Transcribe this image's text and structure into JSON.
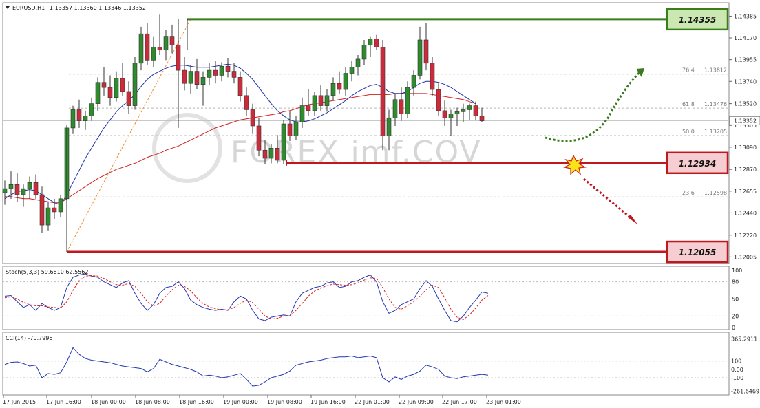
{
  "header": {
    "title": "EURUSD,H1",
    "ohlc": "1.13357 1.13360 1.13346 1.13352"
  },
  "watermark": "FOREX imf.COV",
  "colors": {
    "bull": "#2e8b2e",
    "bear": "#cc2b3b",
    "ma_slow": "#d42020",
    "ma_fast": "#1f2fa8",
    "stoch_main": "#2436b0",
    "stoch_signal": "#d42020",
    "cci": "#2436b0",
    "resistance": "#3a7d1a",
    "support": "#c0181f"
  },
  "chart_data": [
    {
      "type": "candlestick",
      "name": "main",
      "ylim": [
        1.1196,
        1.1449
      ],
      "y_ticks": [
        "1.14385",
        "1.14170",
        "1.13955",
        "1.13740",
        "1.13520",
        "1.13305",
        "1.13090",
        "1.12870",
        "1.12655",
        "1.12440",
        "1.12220",
        "1.12005"
      ],
      "price_label": "1.13352",
      "last_price": 1.13352,
      "x_labels": [
        "17 Jun 2015",
        "17 Jun 16:00",
        "18 Jun 00:00",
        "18 Jun 08:00",
        "18 Jun 16:00",
        "19 Jun 00:00",
        "19 Jun 08:00",
        "19 Jun 16:00",
        "22 Jun 01:00",
        "22 Jun 09:00",
        "22 Jun 17:00",
        "23 Jun 01:00"
      ],
      "ohlc": [
        [
          1.1264,
          1.1276,
          1.1252,
          1.1268
        ],
        [
          1.1268,
          1.1285,
          1.1258,
          1.1272
        ],
        [
          1.1272,
          1.1283,
          1.1255,
          1.1262
        ],
        [
          1.1262,
          1.1272,
          1.125,
          1.1268
        ],
        [
          1.1268,
          1.128,
          1.1258,
          1.1274
        ],
        [
          1.1274,
          1.1282,
          1.1258,
          1.1262
        ],
        [
          1.1262,
          1.127,
          1.1224,
          1.1232
        ],
        [
          1.1232,
          1.1255,
          1.1226,
          1.1249
        ],
        [
          1.1249,
          1.1258,
          1.1238,
          1.1245
        ],
        [
          1.1245,
          1.1262,
          1.124,
          1.1258
        ],
        [
          1.1258,
          1.1331,
          1.1252,
          1.1328
        ],
        [
          1.1328,
          1.135,
          1.1322,
          1.1346
        ],
        [
          1.1346,
          1.1356,
          1.1328,
          1.1335
        ],
        [
          1.1335,
          1.1345,
          1.1326,
          1.134
        ],
        [
          1.134,
          1.1358,
          1.1335,
          1.1352
        ],
        [
          1.1352,
          1.1378,
          1.1345,
          1.1373
        ],
        [
          1.1373,
          1.1388,
          1.136,
          1.1368
        ],
        [
          1.1368,
          1.138,
          1.135,
          1.1358
        ],
        [
          1.1358,
          1.1384,
          1.1354,
          1.1377
        ],
        [
          1.1377,
          1.1392,
          1.136,
          1.1364
        ],
        [
          1.1364,
          1.1374,
          1.1342,
          1.135
        ],
        [
          1.135,
          1.1398,
          1.1346,
          1.1392
        ],
        [
          1.1392,
          1.1428,
          1.1385,
          1.1421
        ],
        [
          1.1421,
          1.1432,
          1.139,
          1.1395
        ],
        [
          1.1395,
          1.1418,
          1.1388,
          1.1408
        ],
        [
          1.1408,
          1.144,
          1.14,
          1.1405
        ],
        [
          1.1405,
          1.1425,
          1.1395,
          1.1418
        ],
        [
          1.1418,
          1.143,
          1.1402,
          1.141
        ],
        [
          1.141,
          1.1436,
          1.1328,
          1.1385
        ],
        [
          1.1385,
          1.1398,
          1.1365,
          1.1372
        ],
        [
          1.1372,
          1.139,
          1.1362,
          1.1384
        ],
        [
          1.1384,
          1.1396,
          1.1366,
          1.1371
        ],
        [
          1.1371,
          1.1384,
          1.135,
          1.1378
        ],
        [
          1.1378,
          1.1392,
          1.137,
          1.1385
        ],
        [
          1.1385,
          1.1394,
          1.1372,
          1.138
        ],
        [
          1.138,
          1.1393,
          1.1374,
          1.1389
        ],
        [
          1.1389,
          1.1397,
          1.1378,
          1.1384
        ],
        [
          1.1384,
          1.1392,
          1.1372,
          1.1378
        ],
        [
          1.1378,
          1.1384,
          1.1354,
          1.136
        ],
        [
          1.136,
          1.1368,
          1.134,
          1.1346
        ],
        [
          1.1346,
          1.1352,
          1.1322,
          1.133
        ],
        [
          1.133,
          1.1338,
          1.13,
          1.1306
        ],
        [
          1.1306,
          1.1316,
          1.1292,
          1.1298
        ],
        [
          1.1298,
          1.1312,
          1.1293,
          1.1308
        ],
        [
          1.1308,
          1.1321,
          1.1293,
          1.1296
        ],
        [
          1.1296,
          1.1336,
          1.1292,
          1.1332
        ],
        [
          1.1332,
          1.1345,
          1.1315,
          1.132
        ],
        [
          1.132,
          1.134,
          1.1316,
          1.1334
        ],
        [
          1.1334,
          1.1358,
          1.1328,
          1.135
        ],
        [
          1.135,
          1.1366,
          1.134,
          1.1345
        ],
        [
          1.1345,
          1.1364,
          1.134,
          1.136
        ],
        [
          1.136,
          1.137,
          1.1345,
          1.135
        ],
        [
          1.135,
          1.1366,
          1.1344,
          1.136
        ],
        [
          1.136,
          1.1378,
          1.1355,
          1.1372
        ],
        [
          1.1372,
          1.1384,
          1.1362,
          1.1366
        ],
        [
          1.1366,
          1.1388,
          1.136,
          1.1382
        ],
        [
          1.1382,
          1.1394,
          1.1374,
          1.1388
        ],
        [
          1.1388,
          1.14,
          1.138,
          1.1396
        ],
        [
          1.1396,
          1.1415,
          1.139,
          1.141
        ],
        [
          1.141,
          1.1418,
          1.1398,
          1.1416
        ],
        [
          1.1416,
          1.142,
          1.1405,
          1.1408
        ],
        [
          1.1408,
          1.1415,
          1.1306,
          1.132
        ],
        [
          1.132,
          1.1346,
          1.1306,
          1.1338
        ],
        [
          1.1338,
          1.1362,
          1.133,
          1.1356
        ],
        [
          1.1356,
          1.1368,
          1.1335,
          1.1342
        ],
        [
          1.1342,
          1.1374,
          1.1338,
          1.1368
        ],
        [
          1.1368,
          1.1385,
          1.136,
          1.138
        ],
        [
          1.138,
          1.1428,
          1.1376,
          1.1415
        ],
        [
          1.1415,
          1.1432,
          1.1385,
          1.1392
        ],
        [
          1.1392,
          1.1398,
          1.136,
          1.1366
        ],
        [
          1.1366,
          1.1372,
          1.134,
          1.1345
        ],
        [
          1.1345,
          1.1355,
          1.133,
          1.1338
        ],
        [
          1.1338,
          1.1346,
          1.132,
          1.1342
        ],
        [
          1.1342,
          1.1348,
          1.133,
          1.1344
        ],
        [
          1.1344,
          1.1352,
          1.1334,
          1.1346
        ],
        [
          1.1346,
          1.1352,
          1.1336,
          1.135
        ],
        [
          1.135,
          1.1354,
          1.1336,
          1.134
        ],
        [
          1.134,
          1.1348,
          1.1334,
          1.1335
        ]
      ],
      "ma_slow": [
        1.126,
        1.126,
        1.1259,
        1.1258,
        1.1258,
        1.1257,
        1.1256,
        1.1255,
        1.1254,
        1.1254,
        1.1258,
        1.1262,
        1.1266,
        1.127,
        1.1274,
        1.1278,
        1.1281,
        1.1284,
        1.1287,
        1.1289,
        1.1291,
        1.1293,
        1.1296,
        1.1299,
        1.1301,
        1.1303,
        1.1306,
        1.1308,
        1.131,
        1.1313,
        1.1316,
        1.1319,
        1.1322,
        1.1325,
        1.1328,
        1.133,
        1.1332,
        1.1334,
        1.1336,
        1.1337,
        1.1338,
        1.1339,
        1.134,
        1.1341,
        1.1342,
        1.1344,
        1.1345,
        1.1347,
        1.1349,
        1.1351,
        1.1352,
        1.1353,
        1.1354,
        1.1355,
        1.1356,
        1.1357,
        1.1358,
        1.1359,
        1.136,
        1.1361,
        1.1361,
        1.1361,
        1.1361,
        1.1362,
        1.1362,
        1.1362,
        1.1362,
        1.1362,
        1.1362,
        1.1361,
        1.136,
        1.1359,
        1.1358,
        1.1357,
        1.1356,
        1.1354,
        1.1352
      ],
      "ma_fast": [
        1.1258,
        1.1262,
        1.1265,
        1.1266,
        1.1267,
        1.1266,
        1.1262,
        1.1258,
        1.1254,
        1.1252,
        1.1262,
        1.1274,
        1.1286,
        1.1298,
        1.1308,
        1.1318,
        1.1328,
        1.1336,
        1.1344,
        1.135,
        1.1355,
        1.1361,
        1.1369,
        1.1376,
        1.1381,
        1.1384,
        1.1387,
        1.1389,
        1.139,
        1.139,
        1.1389,
        1.1388,
        1.1388,
        1.1388,
        1.1389,
        1.139,
        1.1391,
        1.139,
        1.1387,
        1.1382,
        1.1376,
        1.1368,
        1.136,
        1.1352,
        1.1345,
        1.134,
        1.1336,
        1.1334,
        1.1334,
        1.1335,
        1.1337,
        1.134,
        1.1343,
        1.1347,
        1.1351,
        1.1355,
        1.136,
        1.1364,
        1.1367,
        1.137,
        1.1371,
        1.1368,
        1.1364,
        1.1362,
        1.1362,
        1.1364,
        1.1368,
        1.1372,
        1.1374,
        1.1374,
        1.1373,
        1.1371,
        1.1368,
        1.1364,
        1.136,
        1.1356,
        1.1352
      ],
      "fibonacci": [
        {
          "label": "76.4",
          "value": 1.13812
        },
        {
          "label": "61.8",
          "value": 1.13476
        },
        {
          "label": "50.0",
          "value": 1.13205
        },
        {
          "label": "23.6",
          "value": 1.12598
        }
      ],
      "levels": [
        {
          "name": "resistance",
          "value": 1.14355,
          "label": "1.14355"
        },
        {
          "name": "support-mid",
          "value": 1.12934,
          "label": "1.12934"
        },
        {
          "name": "support-low",
          "value": 1.12055,
          "label": "1.12055"
        }
      ]
    },
    {
      "type": "line",
      "name": "stochastic",
      "header": "Stoch(5,3,3) 59.6610 62.5562",
      "ylim": [
        0,
        100
      ],
      "y_ticks": [
        "100",
        "80",
        "50",
        "20",
        "0"
      ],
      "series": [
        {
          "name": "main",
          "values": [
            55,
            56,
            45,
            35,
            40,
            30,
            42,
            35,
            30,
            35,
            70,
            88,
            92,
            94,
            90,
            88,
            80,
            75,
            70,
            78,
            82,
            60,
            42,
            30,
            40,
            60,
            70,
            72,
            80,
            68,
            48,
            40,
            35,
            32,
            30,
            32,
            30,
            45,
            55,
            50,
            30,
            15,
            12,
            18,
            20,
            22,
            20,
            45,
            60,
            65,
            70,
            72,
            78,
            80,
            70,
            72,
            80,
            82,
            88,
            92,
            80,
            45,
            25,
            30,
            40,
            45,
            50,
            68,
            82,
            72,
            50,
            30,
            12,
            10,
            20,
            35,
            48,
            62,
            60
          ]
        },
        {
          "name": "signal",
          "values": [
            52,
            54,
            50,
            44,
            40,
            38,
            38,
            36,
            35,
            34,
            45,
            65,
            82,
            90,
            91,
            90,
            86,
            80,
            75,
            74,
            77,
            72,
            60,
            45,
            38,
            42,
            55,
            66,
            74,
            72,
            64,
            52,
            42,
            36,
            33,
            31,
            31,
            35,
            42,
            48,
            44,
            32,
            20,
            15,
            16,
            20,
            21,
            30,
            42,
            55,
            64,
            69,
            73,
            76,
            75,
            74,
            75,
            78,
            83,
            87,
            86,
            70,
            50,
            35,
            32,
            38,
            45,
            55,
            66,
            74,
            70,
            52,
            32,
            18,
            14,
            22,
            34,
            48,
            56
          ]
        }
      ]
    },
    {
      "type": "line",
      "name": "cci",
      "header": "CCI(14) -70.7996",
      "ylim": [
        -290,
        395
      ],
      "y_ticks": [
        "365.2911",
        "100",
        "0.00",
        "-100",
        "-261.6469"
      ],
      "series": [
        {
          "name": "CCI",
          "values": [
            60,
            85,
            90,
            70,
            40,
            50,
            -100,
            -50,
            -60,
            -40,
            90,
            260,
            180,
            130,
            110,
            100,
            90,
            80,
            60,
            40,
            30,
            20,
            10,
            -30,
            10,
            120,
            90,
            60,
            40,
            20,
            0,
            -30,
            -80,
            -70,
            -80,
            -100,
            -90,
            -70,
            -50,
            -120,
            -200,
            -190,
            -150,
            -100,
            -80,
            -60,
            -20,
            50,
            70,
            90,
            100,
            110,
            130,
            140,
            150,
            150,
            160,
            140,
            150,
            160,
            140,
            -100,
            -150,
            -90,
            -120,
            -80,
            -60,
            -20,
            50,
            30,
            0,
            -80,
            -100,
            -110,
            -90,
            -80,
            -70,
            -60,
            -70
          ]
        }
      ]
    }
  ]
}
